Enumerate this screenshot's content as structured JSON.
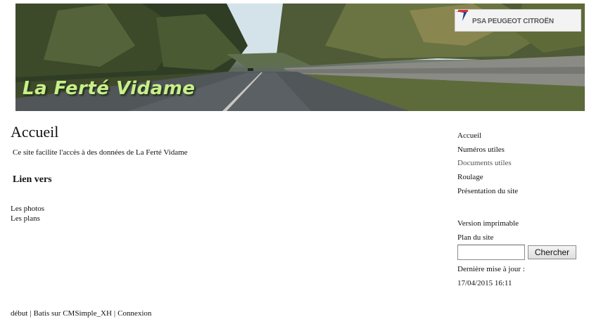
{
  "banner": {
    "title": "La Ferté Vidame",
    "logo_text": "PSA PEUGEOT CITROËN"
  },
  "main": {
    "title": "Accueil",
    "intro": "Ce site facilite l'accès à des données de La Ferté Vidame",
    "section_title": "Lien vers",
    "links": [
      "Les photos",
      "Les plans"
    ]
  },
  "sidebar": {
    "menu": [
      {
        "label": "Accueil"
      },
      {
        "label": "Numéros utiles"
      },
      {
        "label": "Documents utiles"
      },
      {
        "label": "Roulage"
      },
      {
        "label": "Présentation du site"
      }
    ],
    "print_label": "Version imprimable",
    "sitemap_label": "Plan du site",
    "search": {
      "value": "",
      "button_label": "Chercher"
    },
    "last_update_label": "Dernière mise à jour :",
    "last_update_date": "17/04/2015 16:11"
  },
  "footer": {
    "items": [
      "début",
      "Batis sur CMSimple_XH",
      "Connexion"
    ],
    "separator": "|"
  }
}
